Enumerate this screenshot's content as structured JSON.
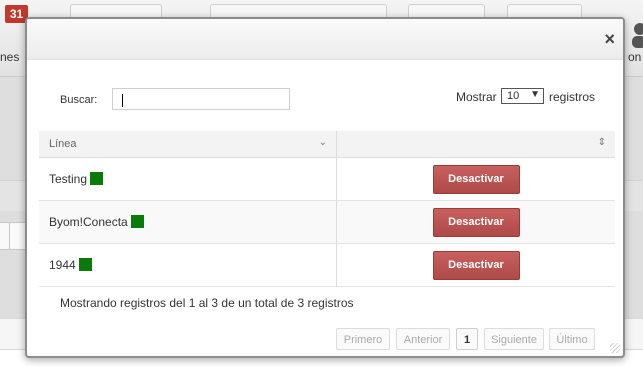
{
  "background": {
    "calendar_day": "31",
    "left_label": "nes",
    "right_label": "on"
  },
  "dialog": {
    "close_glyph": "×",
    "search": {
      "label": "Buscar:",
      "value": "",
      "placeholder": ""
    },
    "length": {
      "label": "Mostrar",
      "value": "10",
      "suffix": "registros"
    },
    "table": {
      "header": "Línea",
      "rows": [
        {
          "name": "Testing",
          "status_color": "#0a7a0a",
          "action": "Desactivar"
        },
        {
          "name": "Byom!Conecta",
          "status_color": "#0a7a0a",
          "action": "Desactivar"
        },
        {
          "name": "1944",
          "status_color": "#0a7a0a",
          "action": "Desactivar"
        }
      ]
    },
    "info": "Mostrando registros del 1 al 3 de un total de 3 registros",
    "pagination": {
      "first": "Primero",
      "previous": "Anterior",
      "current": "1",
      "next": "Siguiente",
      "last": "Último"
    }
  },
  "colors": {
    "status_green": "#0a7a0a",
    "danger": "#b9504e"
  }
}
